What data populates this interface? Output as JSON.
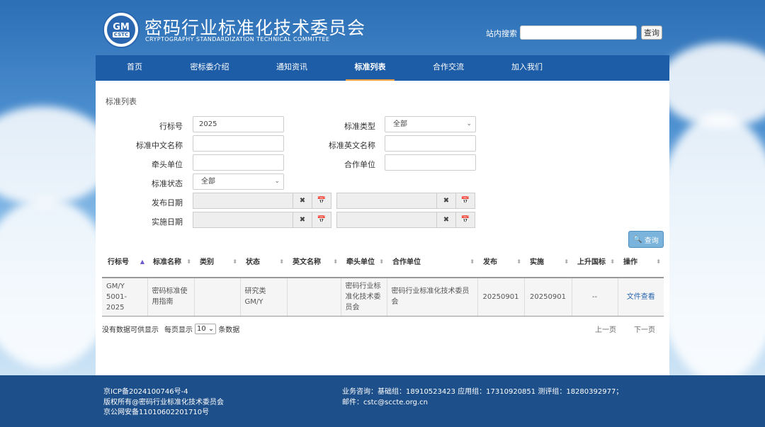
{
  "header": {
    "logo_text_main": "GM",
    "logo_text_sub": "CSTC",
    "title": "密码行业标准化技术委员会",
    "subtitle": "CRYPTOGRAPHY STANDARDIZATION TECHNICAL COMMITTEE",
    "search_label": "站内搜索",
    "search_placeholder": "",
    "search_button": "查询"
  },
  "nav": {
    "items": [
      "首页",
      "密标委介绍",
      "通知资讯",
      "标准列表",
      "合作交流",
      "加入我们"
    ],
    "active_index": 3
  },
  "main": {
    "breadcrumb": "标准列表",
    "form": {
      "industry_no_label": "行标号",
      "industry_no_value": "2025",
      "std_type_label": "标准类型",
      "std_type_value": "全部",
      "cn_name_label": "标准中文名称",
      "cn_name_value": "",
      "en_name_label": "标准英文名称",
      "en_name_value": "",
      "lead_unit_label": "牵头单位",
      "lead_unit_value": "",
      "coop_unit_label": "合作单位",
      "coop_unit_value": "",
      "status_label": "标准状态",
      "status_value": "全部",
      "publish_date_label": "发布日期",
      "implement_date_label": "实施日期",
      "clear_glyph": "✖",
      "calendar_glyph": "📅",
      "query_button": "查询"
    },
    "table": {
      "headers": [
        "行标号",
        "标准名称",
        "类别",
        "状态",
        "英文名称",
        "牵头单位",
        "合作单位",
        "发布",
        "实施",
        "上升国标",
        "操作"
      ],
      "rows": [
        {
          "code": "GM/Y 5001-2025",
          "name": "密码标准使用指南",
          "category": "",
          "status": "研究类 GM/Y",
          "en_name": "",
          "lead": "密码行业标准化技术委员会",
          "coop": "密码行业标准化技术委员会",
          "publish": "20250901",
          "implement": "20250901",
          "national": "--",
          "action": "文件查看"
        }
      ]
    },
    "footer_info": {
      "no_data_text": "没有数据可供显示",
      "per_page_prefix": "每页显示",
      "per_page_value": "10",
      "per_page_suffix": "条数据",
      "prev": "上一页",
      "next": "下一页"
    }
  },
  "footer": {
    "icp": "京ICP备2024100746号-4",
    "copyright": "版权所有@密码行业标准化技术委员会",
    "police": "京公网安备11010602201710号",
    "contact": "业务咨询：基础组：18910523423 应用组：17310920851 测评组：18280392977；",
    "email": "邮件：cstc@sccte.org.cn"
  },
  "colors": {
    "brand_blue": "#1d5ca6",
    "footer_blue": "#1d4f8a",
    "active_underline": "#f0a040",
    "query_button": "#7ab3db",
    "link": "#2a67b0"
  }
}
